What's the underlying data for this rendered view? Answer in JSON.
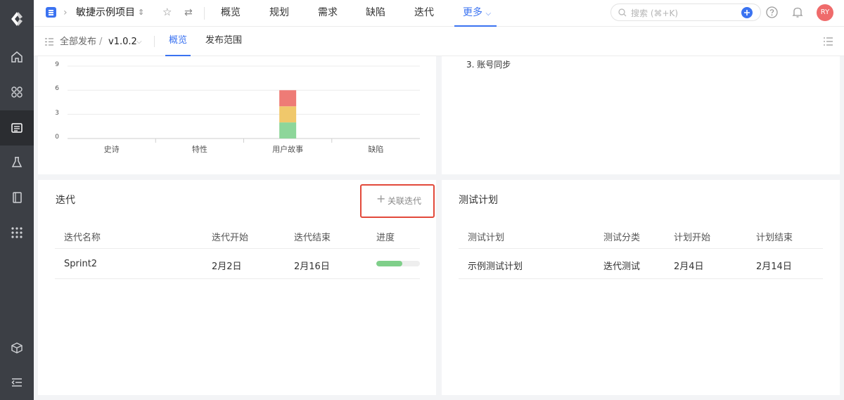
{
  "app": {
    "project_name": "敏捷示例项目",
    "nav": [
      {
        "label": "概览",
        "active": false
      },
      {
        "label": "规划",
        "active": false
      },
      {
        "label": "需求",
        "active": false
      },
      {
        "label": "缺陷",
        "active": false
      },
      {
        "label": "迭代",
        "active": false
      },
      {
        "label": "更多",
        "active": true
      }
    ],
    "search_placeholder": "搜索 (⌘+K)",
    "user_initials": "RY",
    "accent": "#3b73f1"
  },
  "sidebar": {
    "items": [
      {
        "icon": "home-icon"
      },
      {
        "icon": "apps-icon"
      },
      {
        "icon": "release-icon",
        "active": true
      },
      {
        "icon": "flask-icon"
      },
      {
        "icon": "book-icon"
      },
      {
        "icon": "grid-icon"
      },
      {
        "icon": "cube-icon"
      },
      {
        "icon": "collapse-icon"
      }
    ]
  },
  "subnav": {
    "breadcrumb_root": "全部发布",
    "separator": "/",
    "version": "v1.0.2",
    "tabs": [
      {
        "label": "概览",
        "active": true
      },
      {
        "label": "发布范围",
        "active": false
      }
    ]
  },
  "chart_data": {
    "type": "bar",
    "categories": [
      "史诗",
      "特性",
      "用户故事",
      "缺陷"
    ],
    "yticks": [
      "9",
      "6",
      "3",
      "0"
    ],
    "ylim": [
      0,
      9
    ],
    "stacked": true,
    "series": [
      {
        "values": [
          0,
          0,
          2,
          0
        ],
        "color": "#8dd69a"
      },
      {
        "values": [
          0,
          0,
          2,
          0
        ],
        "color": "#f0c86b"
      },
      {
        "values": [
          0,
          0,
          2,
          0
        ],
        "color": "#ee7b76"
      }
    ],
    "grid": true
  },
  "notes": {
    "line": "3. 账号同步"
  },
  "iterations": {
    "title": "迭代",
    "link_button": "关联迭代",
    "columns": [
      "迭代名称",
      "迭代开始",
      "迭代结束",
      "进度"
    ],
    "rows": [
      {
        "name": "Sprint2",
        "start": "2月2日",
        "end": "2月16日",
        "progress": 0.6
      }
    ]
  },
  "test_plans": {
    "title": "测试计划",
    "columns": [
      "测试计划",
      "测试分类",
      "计划开始",
      "计划结束"
    ],
    "rows": [
      {
        "name": "示例测试计划",
        "category": "迭代测试",
        "start": "2月4日",
        "end": "2月14日"
      }
    ]
  }
}
